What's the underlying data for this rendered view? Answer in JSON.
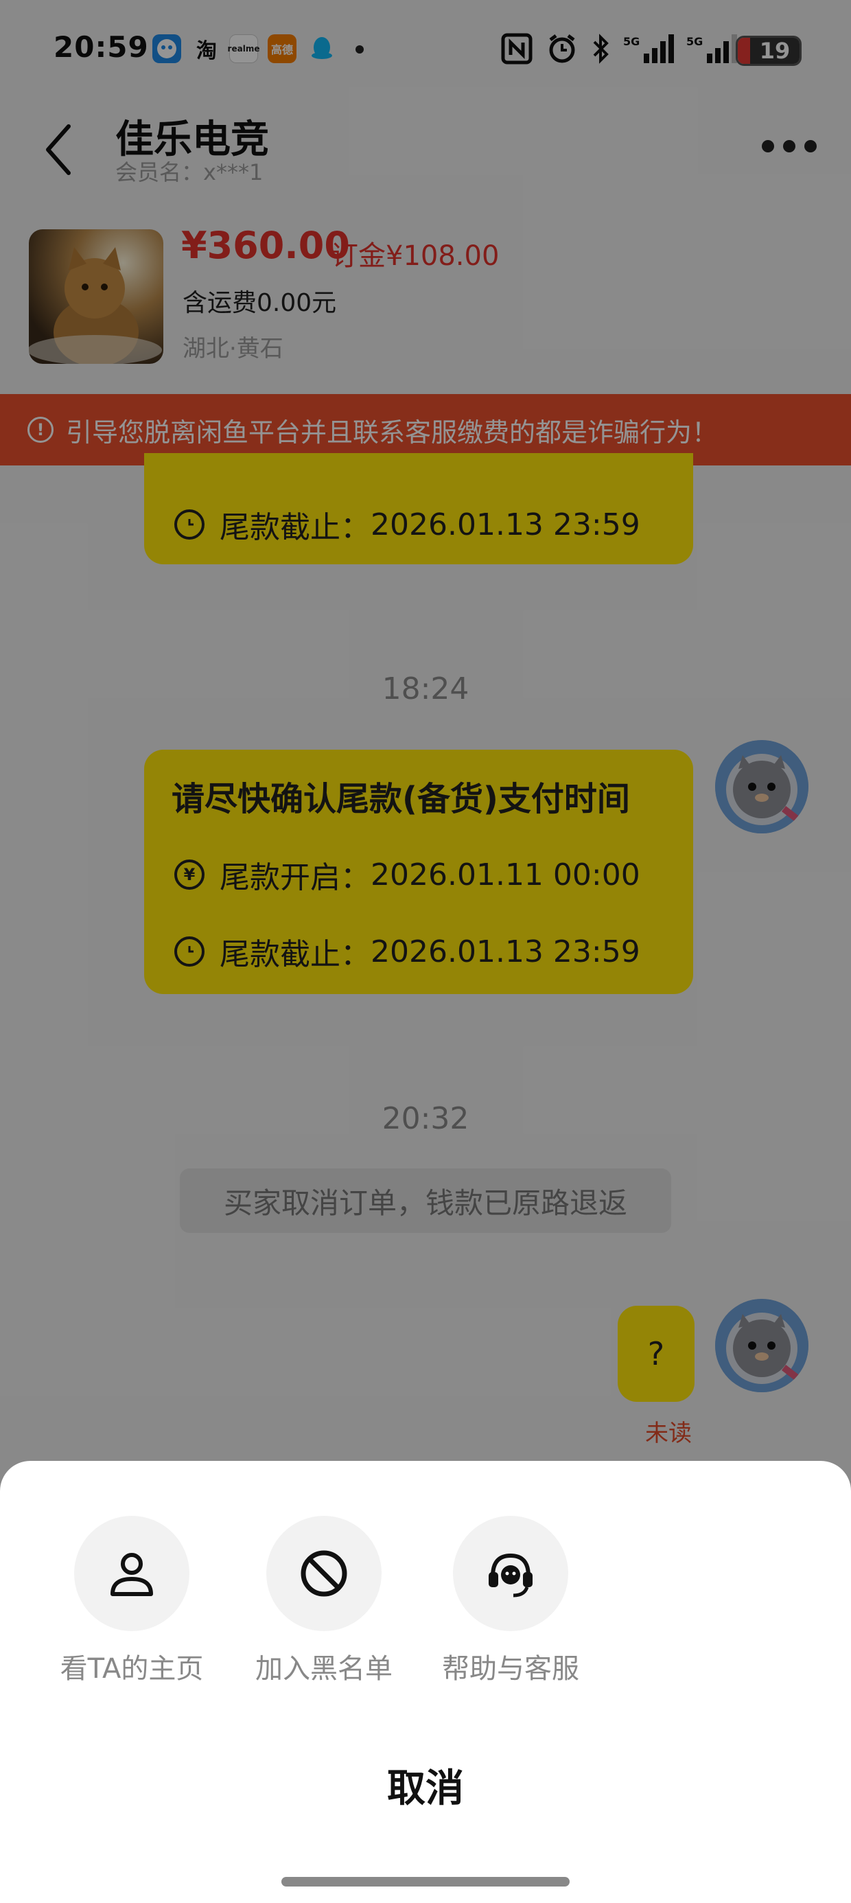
{
  "status_bar": {
    "time": "20:59",
    "apps": [
      "taobao-app-icon",
      "realme-app-icon",
      "gaode-app-icon",
      "qq-app-icon"
    ],
    "battery": "19"
  },
  "header": {
    "title": "佳乐电竞",
    "subtitle": "会员名：x***1"
  },
  "product": {
    "price": "¥360.00",
    "deposit": "订金¥108.00",
    "shipping": "含运费0.00元",
    "location": "湖北·黄石"
  },
  "warning": {
    "text": "引导您脱离闲鱼平台并且联系客服缴费的都是诈骗行为！"
  },
  "chat": {
    "bubble1": {
      "deadline_label": "尾款截止：",
      "deadline_value": "2026.01.13 23:59"
    },
    "time1": "18:24",
    "bubble2": {
      "title": "请尽快确认尾款(备货)支付时间",
      "start_label": "尾款开启：",
      "start_value": "2026.01.11 00:00",
      "deadline_label": "尾款截止：",
      "deadline_value": "2026.01.13 23:59"
    },
    "time2": "20:32",
    "system_message": "买家取消订单，钱款已原路退返",
    "bubble3": "?",
    "read_status": "未读"
  },
  "sheet": {
    "actions": [
      {
        "label": "看TA的主页",
        "icon": "person-icon"
      },
      {
        "label": "加入黑名单",
        "icon": "block-icon"
      },
      {
        "label": "帮助与客服",
        "icon": "headset-icon"
      }
    ],
    "cancel": "取消"
  },
  "colors": {
    "accent_yellow": "#ffe50b",
    "price_red": "#e0322b",
    "banner_red": "#e8502e"
  }
}
